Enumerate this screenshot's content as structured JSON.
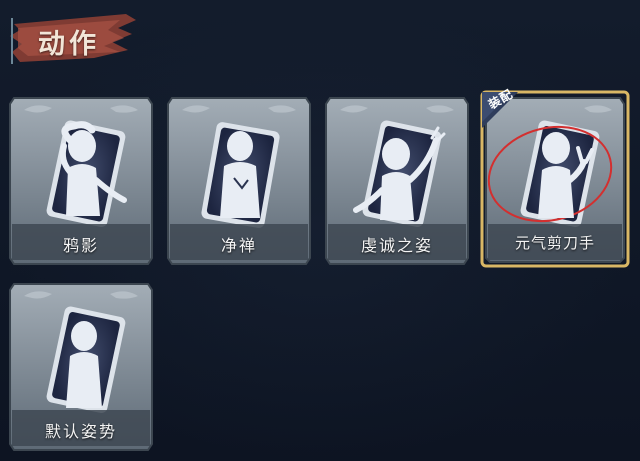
{
  "title": "动作",
  "equip_tag": "装配",
  "cards": [
    {
      "label": "鸦影",
      "pose": "hand-on-head",
      "equipped": false
    },
    {
      "label": "净禅",
      "pose": "praying",
      "equipped": false
    },
    {
      "label": "虔诚之姿",
      "pose": "arm-raised",
      "equipped": false
    },
    {
      "label": "元气剪刀手",
      "pose": "peace-sign",
      "equipped": true
    },
    {
      "label": "默认姿势",
      "pose": "default",
      "equipped": false
    }
  ],
  "colors": {
    "background": "#0f1726",
    "card_frame": "#7f8c96",
    "portrait": "#2a3350",
    "silhouette": "#e6ebf2",
    "equipped_border": "#d9b765",
    "equip_tag_bg": "#2f3d5c",
    "title_banner": "#9a4a3c",
    "annotation_circle": "#d32f2f"
  }
}
